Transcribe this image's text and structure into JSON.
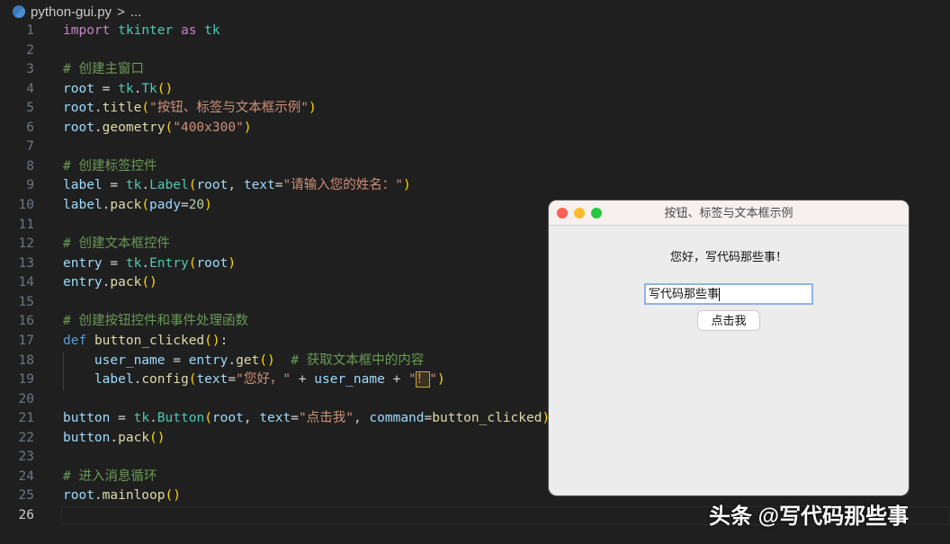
{
  "breadcrumb": {
    "file": "python-gui.py",
    "sep": ">",
    "more": "..."
  },
  "editor": {
    "current_line": 26,
    "lines": [
      [
        [
          "import",
          "kw"
        ],
        [
          " ",
          "pl"
        ],
        [
          "tkinter",
          "mod"
        ],
        [
          " ",
          "pl"
        ],
        [
          "as",
          "kw"
        ],
        [
          " ",
          "pl"
        ],
        [
          "tk",
          "mod"
        ]
      ],
      [],
      [
        [
          "# 创建主窗口",
          "com"
        ]
      ],
      [
        [
          "root",
          "var"
        ],
        [
          " = ",
          "pl"
        ],
        [
          "tk",
          "mod"
        ],
        [
          ".",
          "pl"
        ],
        [
          "Tk",
          "mod"
        ],
        [
          "()",
          "br"
        ]
      ],
      [
        [
          "root",
          "var"
        ],
        [
          ".",
          "pl"
        ],
        [
          "title",
          "fn"
        ],
        [
          "(",
          "br"
        ],
        [
          "\"按钮、标签与文本框示例\"",
          "str"
        ],
        [
          ")",
          "br"
        ]
      ],
      [
        [
          "root",
          "var"
        ],
        [
          ".",
          "pl"
        ],
        [
          "geometry",
          "fn"
        ],
        [
          "(",
          "br"
        ],
        [
          "\"400x300\"",
          "str"
        ],
        [
          ")",
          "br"
        ]
      ],
      [],
      [
        [
          "# 创建标签控件",
          "com"
        ]
      ],
      [
        [
          "label",
          "var"
        ],
        [
          " = ",
          "pl"
        ],
        [
          "tk",
          "mod"
        ],
        [
          ".",
          "pl"
        ],
        [
          "Label",
          "mod"
        ],
        [
          "(",
          "br"
        ],
        [
          "root",
          "var"
        ],
        [
          ", ",
          "pl"
        ],
        [
          "text",
          "var"
        ],
        [
          "=",
          "pl"
        ],
        [
          "\"请输入您的姓名：\"",
          "str"
        ],
        [
          ")",
          "br"
        ]
      ],
      [
        [
          "label",
          "var"
        ],
        [
          ".",
          "pl"
        ],
        [
          "pack",
          "fn"
        ],
        [
          "(",
          "br"
        ],
        [
          "pady",
          "var"
        ],
        [
          "=",
          "pl"
        ],
        [
          "20",
          "num"
        ],
        [
          ")",
          "br"
        ]
      ],
      [],
      [
        [
          "# 创建文本框控件",
          "com"
        ]
      ],
      [
        [
          "entry",
          "var"
        ],
        [
          " = ",
          "pl"
        ],
        [
          "tk",
          "mod"
        ],
        [
          ".",
          "pl"
        ],
        [
          "Entry",
          "mod"
        ],
        [
          "(",
          "br"
        ],
        [
          "root",
          "var"
        ],
        [
          ")",
          "br"
        ]
      ],
      [
        [
          "entry",
          "var"
        ],
        [
          ".",
          "pl"
        ],
        [
          "pack",
          "fn"
        ],
        [
          "()",
          "br"
        ]
      ],
      [],
      [
        [
          "# 创建按钮控件和事件处理函数",
          "com"
        ]
      ],
      [
        [
          "def",
          "def"
        ],
        [
          " ",
          "pl"
        ],
        [
          "button_clicked",
          "fn"
        ],
        [
          "()",
          "br"
        ],
        [
          ":",
          "pl"
        ]
      ],
      [
        [
          "    ",
          "pl"
        ],
        [
          "user_name",
          "var"
        ],
        [
          " = ",
          "pl"
        ],
        [
          "entry",
          "var"
        ],
        [
          ".",
          "pl"
        ],
        [
          "get",
          "fn"
        ],
        [
          "()",
          "br"
        ],
        [
          "  ",
          "pl"
        ],
        [
          "# 获取文本框中的内容",
          "com"
        ]
      ],
      [
        [
          "    ",
          "pl"
        ],
        [
          "label",
          "var"
        ],
        [
          ".",
          "pl"
        ],
        [
          "config",
          "fn"
        ],
        [
          "(",
          "br"
        ],
        [
          "text",
          "var"
        ],
        [
          "=",
          "pl"
        ],
        [
          "\"您好，\"",
          "str"
        ],
        [
          " + ",
          "pl"
        ],
        [
          "user_name",
          "var"
        ],
        [
          " + ",
          "pl"
        ],
        [
          "\"",
          "str"
        ],
        [
          "！",
          "str hl"
        ],
        [
          "\"",
          "str"
        ],
        [
          ")",
          "br"
        ]
      ],
      [],
      [
        [
          "button",
          "var"
        ],
        [
          " = ",
          "pl"
        ],
        [
          "tk",
          "mod"
        ],
        [
          ".",
          "pl"
        ],
        [
          "Button",
          "mod"
        ],
        [
          "(",
          "br"
        ],
        [
          "root",
          "var"
        ],
        [
          ", ",
          "pl"
        ],
        [
          "text",
          "var"
        ],
        [
          "=",
          "pl"
        ],
        [
          "\"点击我\"",
          "str"
        ],
        [
          ", ",
          "pl"
        ],
        [
          "command",
          "var"
        ],
        [
          "=",
          "pl"
        ],
        [
          "button_clicked",
          "fn"
        ],
        [
          ")",
          "br"
        ]
      ],
      [
        [
          "button",
          "var"
        ],
        [
          ".",
          "pl"
        ],
        [
          "pack",
          "fn"
        ],
        [
          "()",
          "br"
        ]
      ],
      [],
      [
        [
          "# 进入消息循环",
          "com"
        ]
      ],
      [
        [
          "root",
          "var"
        ],
        [
          ".",
          "pl"
        ],
        [
          "mainloop",
          "fn"
        ],
        [
          "()",
          "br"
        ]
      ],
      []
    ]
  },
  "tk_window": {
    "title": "按钮、标签与文本框示例",
    "label": "您好，写代码那些事！",
    "entry_value": "写代码那些事",
    "button": "点击我"
  },
  "watermark": "头条 @写代码那些事",
  "colors": {
    "close": "#ff5f57",
    "minimize": "#febc2e",
    "zoom": "#28c840"
  }
}
